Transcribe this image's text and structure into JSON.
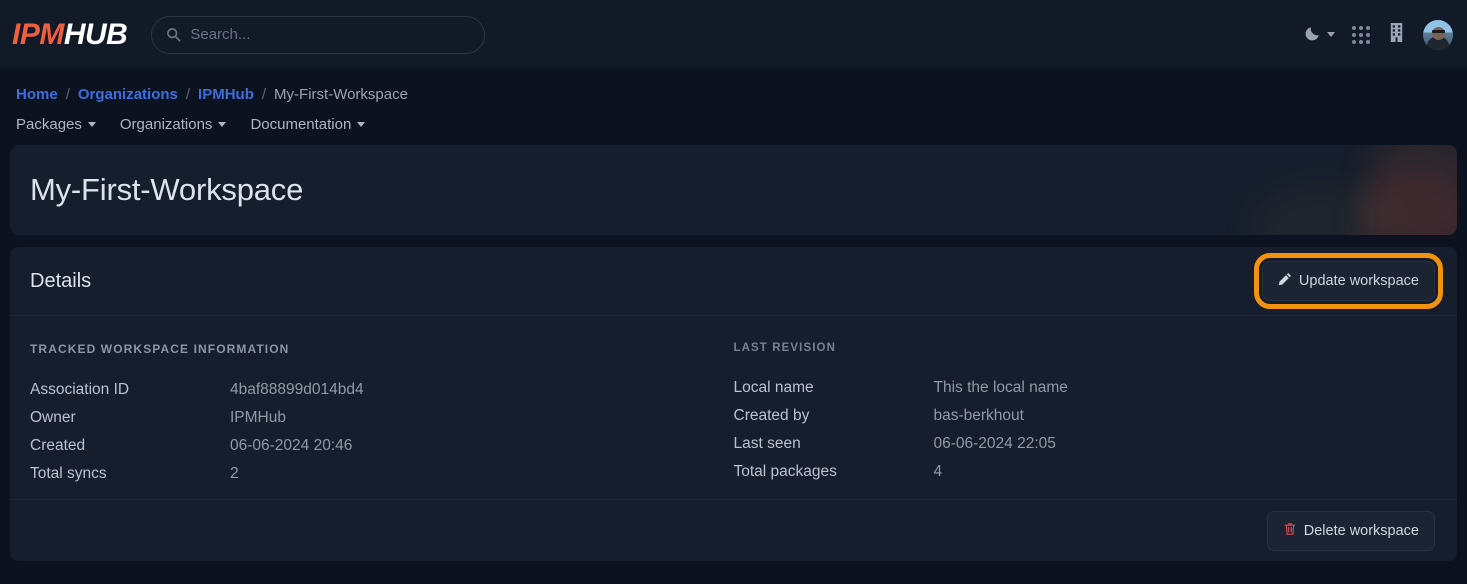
{
  "brand": {
    "name_primary": "IPM",
    "name_secondary": "HUB"
  },
  "search": {
    "placeholder": "Search...",
    "value": ""
  },
  "topbar": {
    "theme_toggle": "moon-icon",
    "apps_icon": "grid-apps-icon",
    "org_icon": "building-icon",
    "avatar": "user-avatar"
  },
  "breadcrumb": {
    "items": [
      {
        "label": "Home",
        "type": "link"
      },
      {
        "label": "Organizations",
        "type": "link"
      },
      {
        "label": "IPMHub",
        "type": "link"
      },
      {
        "label": "My-First-Workspace",
        "type": "current"
      }
    ],
    "separator": "/"
  },
  "nav": {
    "items": [
      {
        "label": "Packages"
      },
      {
        "label": "Organizations"
      },
      {
        "label": "Documentation"
      }
    ]
  },
  "hero": {
    "title": "My-First-Workspace"
  },
  "details": {
    "heading": "Details",
    "update_button": "Update workspace",
    "delete_button": "Delete workspace",
    "left": {
      "title": "TRACKED WORKSPACE INFORMATION",
      "rows": [
        {
          "key": "Association ID",
          "value": "4baf88899d014bd4"
        },
        {
          "key": "Owner",
          "value": "IPMHub"
        },
        {
          "key": "Created",
          "value": "06-06-2024 20:46"
        },
        {
          "key": "Total syncs",
          "value": "2"
        }
      ]
    },
    "right": {
      "title": "LAST REVISION",
      "rows": [
        {
          "key": "Local name",
          "value": "This the local name"
        },
        {
          "key": "Created by",
          "value": "bas-berkhout"
        },
        {
          "key": "Last seen",
          "value": "06-06-2024 22:05"
        },
        {
          "key": "Total packages",
          "value": "4"
        }
      ]
    }
  },
  "colors": {
    "brand_orange": "#ef5f3f",
    "highlight_ring": "#f2920f",
    "link_blue": "#3b6fe0",
    "danger_red": "#e5484d",
    "page_bg": "#0d1220",
    "card_bg": "#161d2c"
  }
}
